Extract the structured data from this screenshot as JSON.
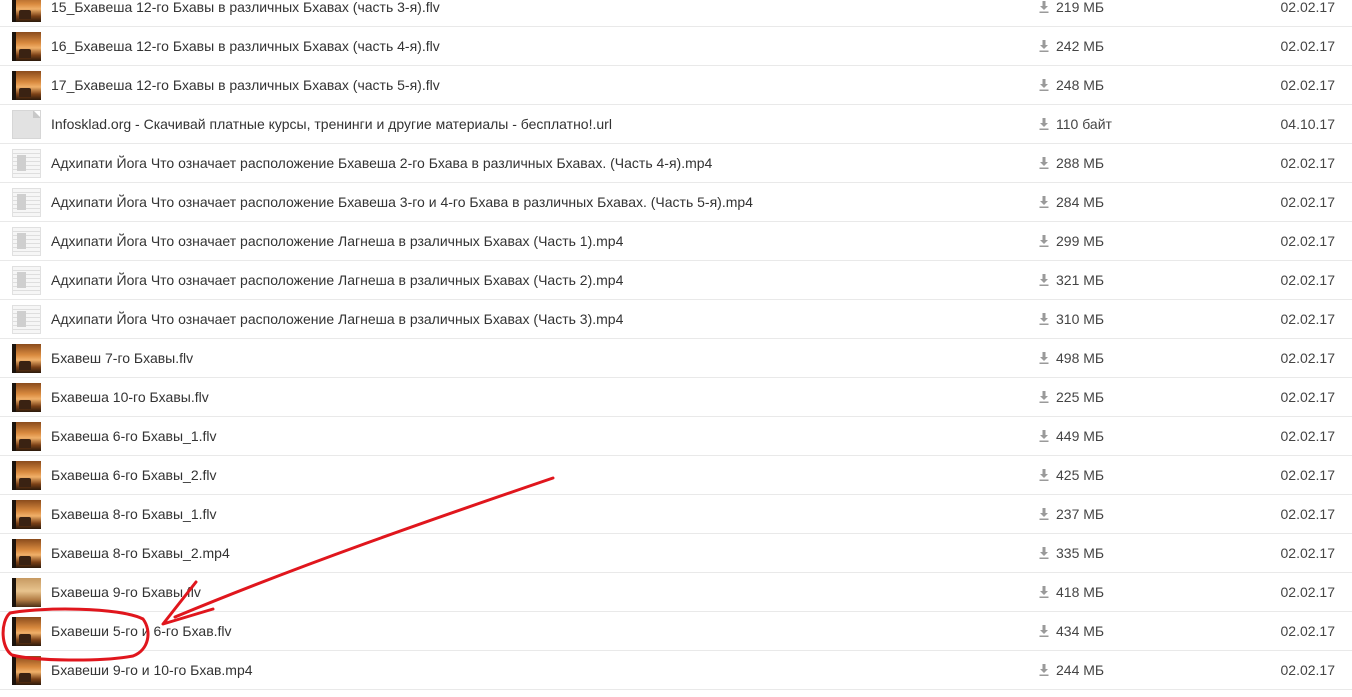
{
  "files": [
    {
      "name": "15_Бхавеша 12-го Бхавы в различных Бхавах (часть 3-я).flv",
      "size": "219 МБ",
      "date": "02.02.17",
      "thumb": "video",
      "thumb_icon": "video-thumbnail"
    },
    {
      "name": "16_Бхавеша 12-го Бхавы в различных Бхавах (часть 4-я).flv",
      "size": "242 МБ",
      "date": "02.02.17",
      "thumb": "video",
      "thumb_icon": "video-thumbnail"
    },
    {
      "name": "17_Бхавеша 12-го Бхавы в различных Бхавах (часть 5-я).flv",
      "size": "248 МБ",
      "date": "02.02.17",
      "thumb": "video",
      "thumb_icon": "video-thumbnail"
    },
    {
      "name": "Infosklad.org - Скачивай платные курсы, тренинги и другие материалы - бесплатно!.url",
      "size": "110 байт",
      "date": "04.10.17",
      "thumb": "doc",
      "thumb_icon": "file-icon"
    },
    {
      "name": "Адхипати Йога Что означает расположение Бхавеша 2-го Бхава в различных Бхавах. (Часть 4-я).mp4",
      "size": "288 МБ",
      "date": "02.02.17",
      "thumb": "screen",
      "thumb_icon": "video-thumbnail"
    },
    {
      "name": "Адхипати Йога Что означает расположение Бхавеша 3-го и 4-го Бхава в различных Бхавах. (Часть 5-я).mp4",
      "size": "284 МБ",
      "date": "02.02.17",
      "thumb": "screen",
      "thumb_icon": "video-thumbnail"
    },
    {
      "name": "Адхипати Йога Что означает расположение Лагнеша в рзаличных Бхавах (Часть 1).mp4",
      "size": "299 МБ",
      "date": "02.02.17",
      "thumb": "screen",
      "thumb_icon": "video-thumbnail"
    },
    {
      "name": "Адхипати Йога Что означает расположение Лагнеша в рзаличных Бхавах (Часть 2).mp4",
      "size": "321 МБ",
      "date": "02.02.17",
      "thumb": "screen",
      "thumb_icon": "video-thumbnail"
    },
    {
      "name": "Адхипати Йога Что означает расположение Лагнеша в рзаличных Бхавах (Часть 3).mp4",
      "size": "310 МБ",
      "date": "02.02.17",
      "thumb": "screen",
      "thumb_icon": "video-thumbnail"
    },
    {
      "name": "Бхавеш 7-го Бхавы.flv",
      "size": "498 МБ",
      "date": "02.02.17",
      "thumb": "video",
      "thumb_icon": "video-thumbnail"
    },
    {
      "name": "Бхавеша 10-го Бхавы.flv",
      "size": "225 МБ",
      "date": "02.02.17",
      "thumb": "video",
      "thumb_icon": "video-thumbnail"
    },
    {
      "name": "Бхавеша 6-го Бхавы_1.flv",
      "size": "449 МБ",
      "date": "02.02.17",
      "thumb": "video",
      "thumb_icon": "video-thumbnail"
    },
    {
      "name": "Бхавеша 6-го Бхавы_2.flv",
      "size": "425 МБ",
      "date": "02.02.17",
      "thumb": "video",
      "thumb_icon": "video-thumbnail"
    },
    {
      "name": "Бхавеша 8-го Бхавы_1.flv",
      "size": "237 МБ",
      "date": "02.02.17",
      "thumb": "video",
      "thumb_icon": "video-thumbnail"
    },
    {
      "name": "Бхавеша 8-го Бхавы_2.mp4",
      "size": "335 МБ",
      "date": "02.02.17",
      "thumb": "video",
      "thumb_icon": "video-thumbnail"
    },
    {
      "name": "Бхавеша 9-го Бхавы.flv",
      "size": "418 МБ",
      "date": "02.02.17",
      "thumb": "video2",
      "thumb_icon": "video-thumbnail"
    },
    {
      "name": "Бхавеши 5-го и 6-го Бхав.flv",
      "size": "434 МБ",
      "date": "02.02.17",
      "thumb": "video",
      "thumb_icon": "video-thumbnail"
    },
    {
      "name": "Бхавеши 9-го и 10-го Бхав.mp4",
      "size": "244 МБ",
      "date": "02.02.17",
      "thumb": "video",
      "thumb_icon": "video-thumbnail"
    }
  ],
  "download_icon": "download-icon",
  "annotation": {
    "color": "#e0161d",
    "highlighted_file_index": 16
  },
  "colors": {
    "text": "#333333",
    "meta_text": "#444444",
    "row_divider": "#e9e9e9",
    "icon": "#9a9a9a"
  }
}
